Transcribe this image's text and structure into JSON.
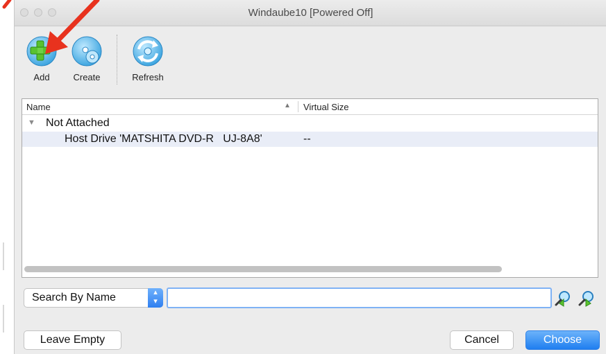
{
  "window": {
    "title": "Windaube10 [Powered Off]"
  },
  "toolbar": {
    "add_label": "Add",
    "create_label": "Create",
    "refresh_label": "Refresh",
    "add_icon": "add-disk-icon",
    "create_icon": "create-disk-icon",
    "refresh_icon": "refresh-icon"
  },
  "list": {
    "columns": {
      "name": "Name",
      "virtual_size": "Virtual Size"
    },
    "groups": [
      {
        "label": "Not Attached",
        "items": [
          {
            "name": "Host Drive 'MATSHITA DVD-R   UJ-8A8'",
            "virtual_size": "--"
          }
        ]
      }
    ]
  },
  "search": {
    "mode": "Search By Name",
    "value": "",
    "placeholder": ""
  },
  "buttons": {
    "leave_empty": "Leave Empty",
    "cancel": "Cancel",
    "choose": "Choose"
  },
  "colors": {
    "accent": "#2f7ff0",
    "selection_row": "#e9edf7",
    "annotation_arrow": "#e8321e"
  }
}
